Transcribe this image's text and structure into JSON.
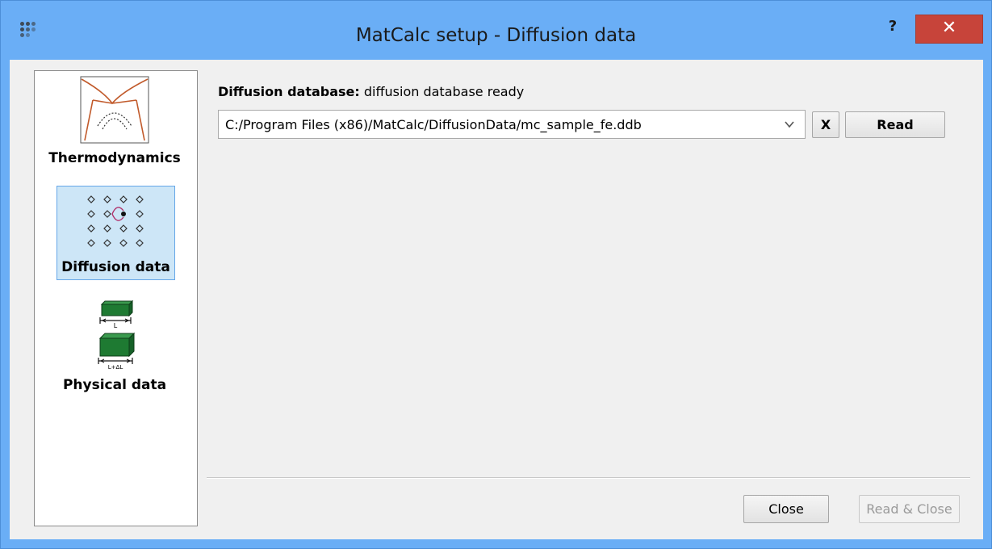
{
  "window": {
    "title": "MatCalc setup - Diffusion data",
    "help_label": "?",
    "close_label": "✕"
  },
  "sidebar": {
    "items": [
      {
        "label": "Thermodynamics",
        "icon": "phase-diagram-icon",
        "selected": false
      },
      {
        "label": "Diffusion data",
        "icon": "lattice-diffusion-icon",
        "selected": true
      },
      {
        "label": "Physical data",
        "icon": "physical-blocks-icon",
        "selected": false
      }
    ]
  },
  "diffusion": {
    "header_label": "Diffusion database:",
    "status": "diffusion database ready",
    "path": "C:/Program Files (x86)/MatCalc/DiffusionData/mc_sample_fe.ddb",
    "clear_label": "X",
    "read_label": "Read"
  },
  "footer": {
    "close_label": "Close",
    "read_close_label": "Read & Close"
  },
  "colors": {
    "titlebar": "#6aaef6",
    "close_button": "#c7443a",
    "selected_item": "#cde6f7",
    "block_green": "#1e7a32"
  }
}
